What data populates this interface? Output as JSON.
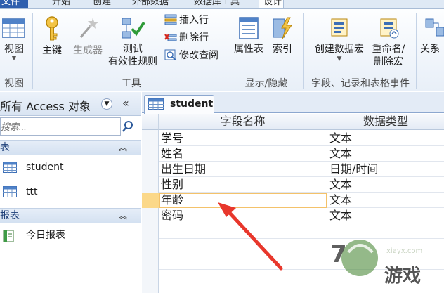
{
  "tabs": {
    "file": "文件",
    "t1": "开始",
    "t2": "创建",
    "t3": "外部数据",
    "t4": "数据库工具",
    "active": "设计"
  },
  "ribbon": {
    "view_label": "视图",
    "group_view": "视图",
    "primary_key": "主键",
    "builder": "生成器",
    "test_validation_line1": "测试",
    "test_validation_line2": "有效性规则",
    "insert_row": "插入行",
    "delete_row": "删除行",
    "modify_lookup": "修改查阅",
    "group_tools": "工具",
    "property_sheet": "属性表",
    "index": "索引",
    "group_show_hide": "显示/隐藏",
    "create_data_macro": "创建数据宏",
    "rename_delete_macro_line1": "重命名/",
    "rename_delete_macro_line2": "删除宏",
    "group_field_events": "字段、记录和表格事件",
    "relations": "关系"
  },
  "nav": {
    "title": "所有 Access 对象",
    "search_placeholder": "搜索...",
    "section_tables": "表",
    "section_reports": "报表",
    "items_tables": [
      "student",
      "ttt"
    ],
    "items_reports": [
      "今日报表"
    ]
  },
  "doc": {
    "tab_title": "student",
    "col_field_name": "字段名称",
    "col_data_type": "数据类型",
    "rows": [
      {
        "field": "学号",
        "type": "文本"
      },
      {
        "field": "姓名",
        "type": "文本"
      },
      {
        "field": "出生日期",
        "type": "日期/时间"
      },
      {
        "field": "性别",
        "type": "文本"
      },
      {
        "field": "年龄",
        "type": "文本"
      },
      {
        "field": "密码",
        "type": "文本"
      }
    ]
  },
  "watermark": {
    "brand": "游戏",
    "url": "xiayx.com"
  },
  "colors": {
    "file_tab": "#2f5fae",
    "current_row_outline": "#f4c26a",
    "arrow": "#e8372c"
  }
}
